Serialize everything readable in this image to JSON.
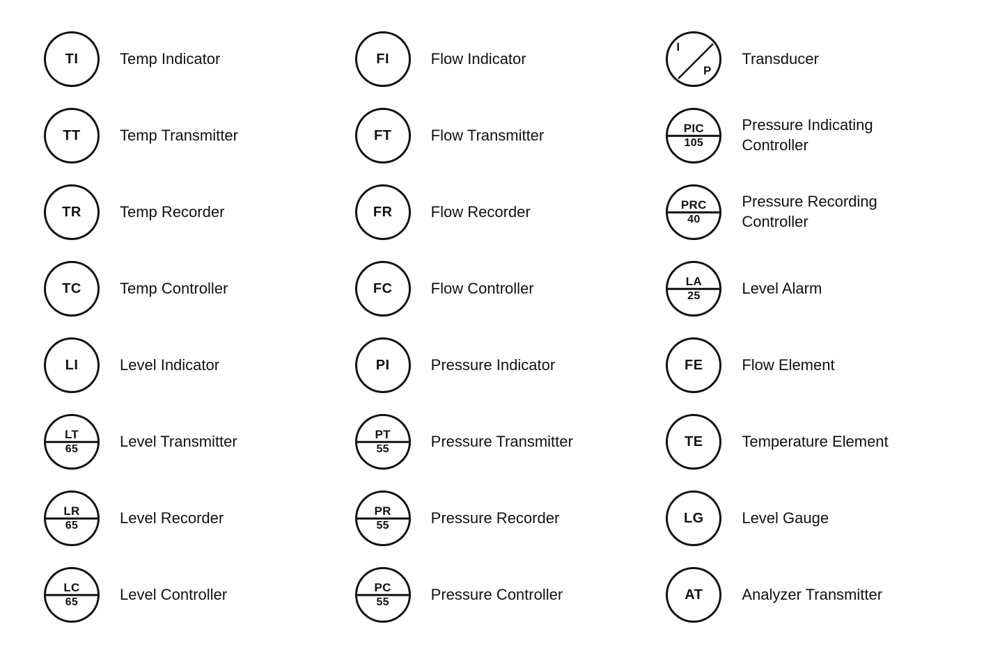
{
  "columns": [
    {
      "id": "col-temp",
      "rows": [
        {
          "id": "ti",
          "symbol_type": "circle",
          "top": "TI",
          "bottom": null,
          "label": "Temp Indicator"
        },
        {
          "id": "tt",
          "symbol_type": "circle",
          "top": "TT",
          "bottom": null,
          "label": "Temp Transmitter"
        },
        {
          "id": "tr",
          "symbol_type": "circle",
          "top": "TR",
          "bottom": null,
          "label": "Temp Recorder"
        },
        {
          "id": "tc",
          "symbol_type": "circle",
          "top": "TC",
          "bottom": null,
          "label": "Temp Controller"
        },
        {
          "id": "li",
          "symbol_type": "circle",
          "top": "LI",
          "bottom": null,
          "label": "Level Indicator"
        },
        {
          "id": "lt",
          "symbol_type": "split",
          "top": "LT",
          "bottom": "65",
          "label": "Level Transmitter"
        },
        {
          "id": "lr",
          "symbol_type": "split",
          "top": "LR",
          "bottom": "65",
          "label": "Level Recorder"
        },
        {
          "id": "lc",
          "symbol_type": "split",
          "top": "LC",
          "bottom": "65",
          "label": "Level Controller"
        }
      ]
    },
    {
      "id": "col-flow",
      "rows": [
        {
          "id": "fi",
          "symbol_type": "circle",
          "top": "FI",
          "bottom": null,
          "label": "Flow Indicator"
        },
        {
          "id": "ft",
          "symbol_type": "circle",
          "top": "FT",
          "bottom": null,
          "label": "Flow Transmitter"
        },
        {
          "id": "fr",
          "symbol_type": "circle",
          "top": "FR",
          "bottom": null,
          "label": "Flow Recorder"
        },
        {
          "id": "fc",
          "symbol_type": "circle",
          "top": "FC",
          "bottom": null,
          "label": "Flow Controller"
        },
        {
          "id": "pi",
          "symbol_type": "circle",
          "top": "PI",
          "bottom": null,
          "label": "Pressure Indicator"
        },
        {
          "id": "pt",
          "symbol_type": "split",
          "top": "PT",
          "bottom": "55",
          "label": "Pressure Transmitter"
        },
        {
          "id": "pr",
          "symbol_type": "split",
          "top": "PR",
          "bottom": "55",
          "label": "Pressure Recorder"
        },
        {
          "id": "pc",
          "symbol_type": "split",
          "top": "PC",
          "bottom": "55",
          "label": "Pressure Controller"
        }
      ]
    },
    {
      "id": "col-misc",
      "rows": [
        {
          "id": "transducer",
          "symbol_type": "diag",
          "top": "I",
          "bottom": "P",
          "label": "Transducer"
        },
        {
          "id": "pic",
          "symbol_type": "split",
          "top": "PIC",
          "bottom": "105",
          "label": "Pressure Indicating\nController"
        },
        {
          "id": "prc",
          "symbol_type": "split",
          "top": "PRC",
          "bottom": "40",
          "label": "Pressure Recording\nController"
        },
        {
          "id": "la",
          "symbol_type": "split",
          "top": "LA",
          "bottom": "25",
          "label": "Level Alarm"
        },
        {
          "id": "fe",
          "symbol_type": "circle",
          "top": "FE",
          "bottom": null,
          "label": "Flow Element"
        },
        {
          "id": "te",
          "symbol_type": "circle",
          "top": "TE",
          "bottom": null,
          "label": "Temperature Element"
        },
        {
          "id": "lg",
          "symbol_type": "circle",
          "top": "LG",
          "bottom": null,
          "label": "Level Gauge"
        },
        {
          "id": "at",
          "symbol_type": "circle",
          "top": "AT",
          "bottom": null,
          "label": "Analyzer Transmitter"
        }
      ]
    }
  ]
}
